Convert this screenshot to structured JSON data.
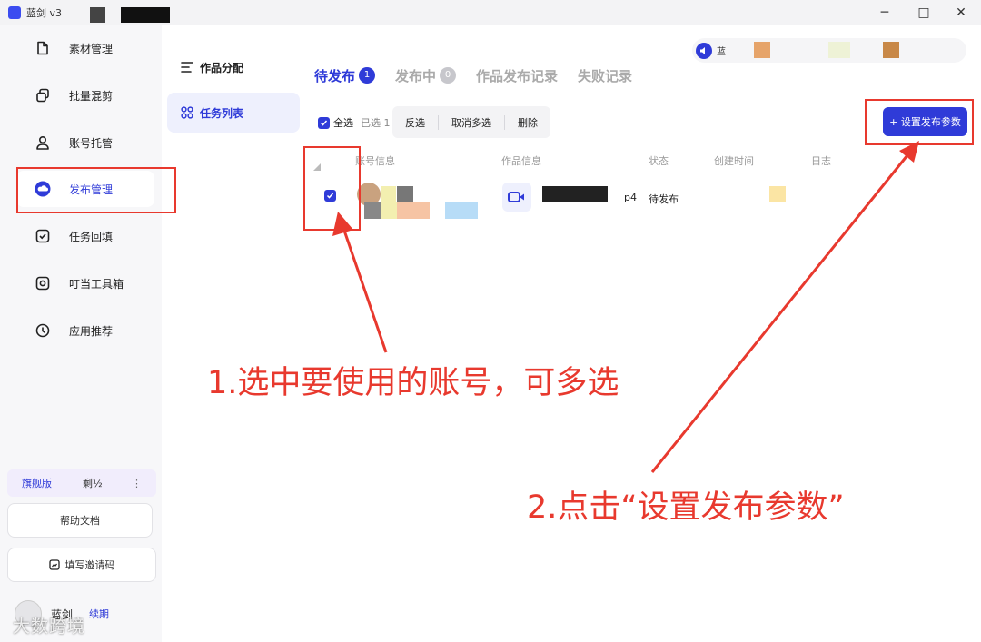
{
  "window": {
    "app_name": "蓝剑 v3",
    "logo_glyph": "",
    "controls": {
      "minimize": "─",
      "maximize": "□",
      "close": "✕"
    }
  },
  "sidebar": {
    "items": [
      {
        "label": "素材管理",
        "icon": "file-icon"
      },
      {
        "label": "批量混剪",
        "icon": "copy-icon"
      },
      {
        "label": "账号托管",
        "icon": "user-icon"
      },
      {
        "label": "发布管理",
        "icon": "cloud-upload-icon",
        "active": true
      },
      {
        "label": "任务回填",
        "icon": "checkbox-icon"
      },
      {
        "label": "叮当工具箱",
        "icon": "toolbox-icon"
      },
      {
        "label": "应用推荐",
        "icon": "compass-icon"
      }
    ],
    "plan": {
      "name": "旗舰版",
      "days": "剩½",
      "more": "⋮"
    },
    "help_label": "帮助文档",
    "invite_label": "填写邀请码",
    "user": {
      "name": "蓝剑",
      "renew": "续期"
    },
    "watermark": "大数跨境"
  },
  "subnav": {
    "items": [
      {
        "label": "作品分配",
        "icon": "list-icon"
      },
      {
        "label": "任务列表",
        "icon": "grid-icon",
        "active": true
      }
    ]
  },
  "notice": {
    "text": "蓝"
  },
  "tabs": [
    {
      "label": "待发布",
      "badge": "1",
      "active": true
    },
    {
      "label": "发布中",
      "badge": "0"
    },
    {
      "label": "作品发布记录"
    },
    {
      "label": "失败记录"
    }
  ],
  "toolbar": {
    "select_all": "全选",
    "selected": "已选 1",
    "actions": [
      "反选",
      "取消多选",
      "删除"
    ],
    "primary": "+ 设置发布参数"
  },
  "table": {
    "headers": [
      "账号信息",
      "作品信息",
      "状态",
      "创建时间",
      "日志"
    ],
    "row": {
      "work_suffix": "p4",
      "status": "待发布"
    }
  },
  "annotations": {
    "step1": "1.选中要使用的账号，可多选",
    "step2": "2.点击“设置发布参数”"
  },
  "colors": {
    "accent": "#2f3bd8",
    "annotation": "#e8392e"
  }
}
